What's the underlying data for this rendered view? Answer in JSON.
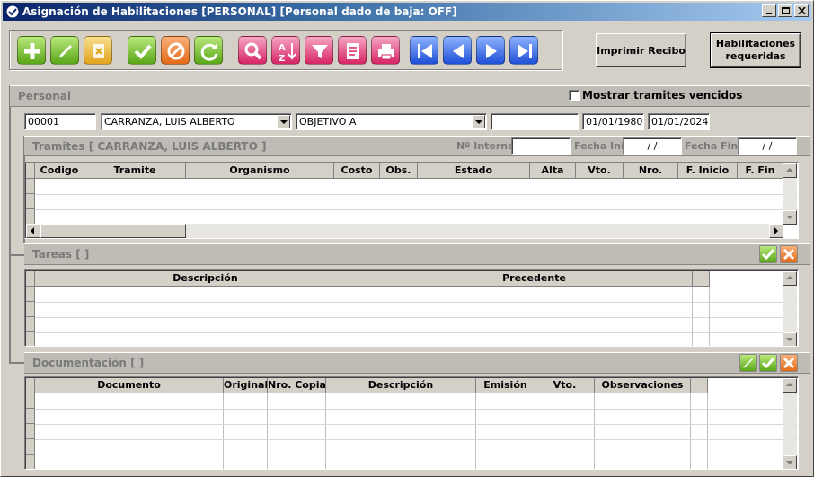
{
  "window": {
    "title": "Asignación de Habilitaciones [PERSONAL] [Personal dado de baja: OFF]"
  },
  "toolbar": {
    "buttons": [
      "add-icon",
      "edit-icon",
      "delete-icon",
      "accept-icon",
      "cancel-icon",
      "refresh-icon",
      "search-icon",
      "sort-icon",
      "filter-icon",
      "notes-icon",
      "print-icon",
      "first-icon",
      "previous-icon",
      "next-icon",
      "last-icon"
    ]
  },
  "actions": {
    "print_receipt": "Imprimir Recibo",
    "required_line1": "Habilitaciones",
    "required_line2": "requeridas"
  },
  "personal": {
    "section_title": "Personal",
    "show_expired_label": "Mostrar tramites vencidos",
    "code": "00001",
    "name": "CARRANZA, LUIS ALBERTO",
    "objective": "OBJETIVO A",
    "extra": "",
    "date_from": "01/01/1980",
    "date_to": "01/01/2024"
  },
  "tramites": {
    "section_title": "Tramites [ CARRANZA, LUIS ALBERTO ]",
    "interno_label": "Nº Interno",
    "interno_value": "",
    "fecha_ini_label": "Fecha Ini",
    "fecha_ini_value": " / /",
    "fecha_fin_label": "Fecha Fin",
    "fecha_fin_value": " / /",
    "columns": [
      "Codigo",
      "Tramite",
      "Organismo",
      "Costo",
      "Obs.",
      "Estado",
      "Alta",
      "Vto.",
      "Nro.",
      "F. Inicio",
      "F. Fin"
    ]
  },
  "tareas": {
    "section_title": "Tareas [ ]",
    "columns": [
      "Descripción",
      "Precedente",
      ""
    ]
  },
  "documentacion": {
    "section_title": "Documentación [ ]",
    "columns": [
      "Documento",
      "Original",
      "Nro. Copias",
      "Descripción",
      "Emisión",
      "Vto.",
      "Observaciones",
      ""
    ]
  }
}
